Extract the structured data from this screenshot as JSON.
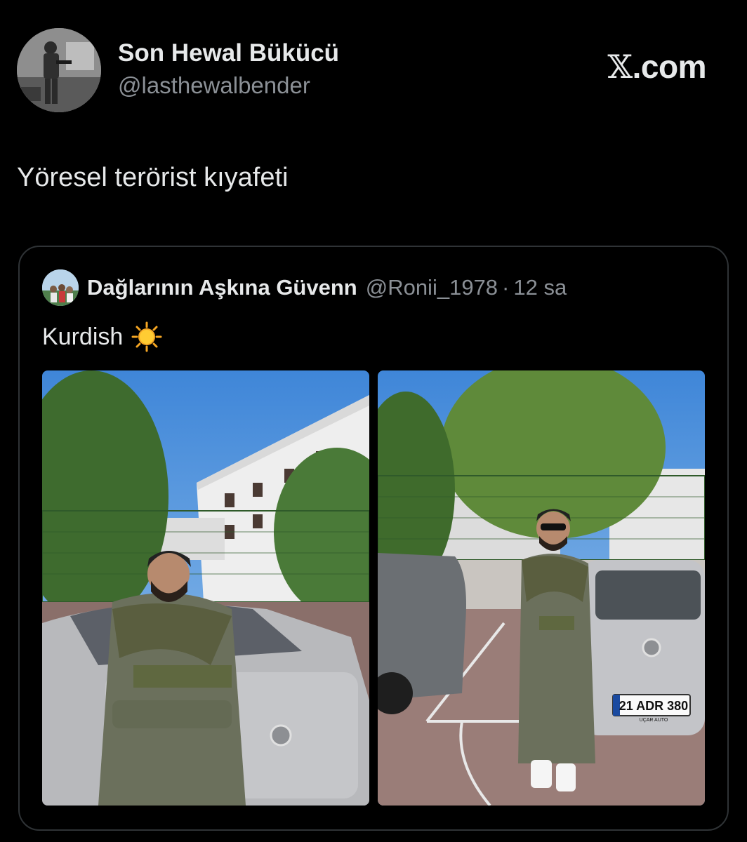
{
  "author": {
    "display_name": "Son Hewal Bükücü",
    "handle": "@lasthewalbender",
    "avatar_icon": "soldier-avatar-photo"
  },
  "brand": {
    "label": "𝕏.com",
    "x_glyph": "𝕏",
    "domain": ".com"
  },
  "tweet": {
    "text": "Yöresel terörist kıyafeti"
  },
  "quoted": {
    "display_name": "Dağlarının Aşkına Güvenn",
    "handle": "@Ronii_1978",
    "separator": "·",
    "time": "12 sa",
    "text": "Kurdish",
    "emoji_icon": "sun-emoji",
    "photos": [
      {
        "label": "photo-1",
        "plate": ""
      },
      {
        "label": "photo-2",
        "plate": "21 ADR 380",
        "dealer": "UÇAR AUTO"
      }
    ]
  },
  "colors": {
    "background": "#000000",
    "text": "#e7e9ea",
    "muted": "#8b9096",
    "border": "#2f3336"
  }
}
